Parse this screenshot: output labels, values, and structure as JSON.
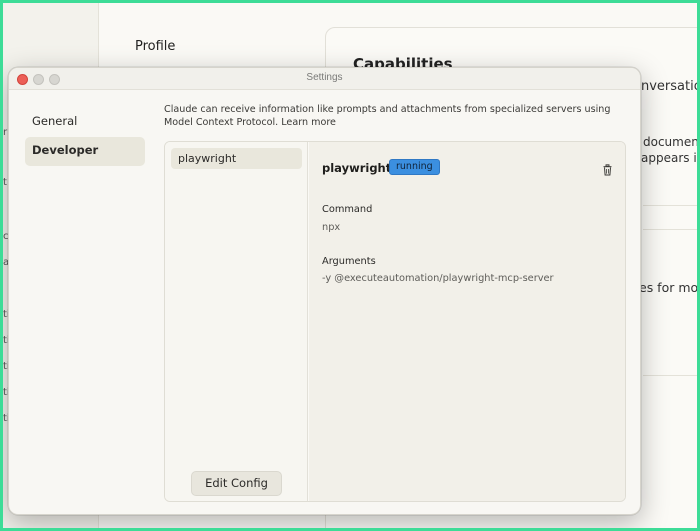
{
  "background": {
    "profile_label": "Profile",
    "capabilities_heading": "Capabilities",
    "fragment_conversation": "nversatio",
    "fragment_documents": "documents",
    "fragment_appears": "appears in",
    "fragment_more": "es for mor",
    "left_clips": [
      "r",
      "t",
      "c",
      "a",
      "ti",
      "ti",
      "ti",
      "ti",
      "ti"
    ]
  },
  "window": {
    "title": "Settings"
  },
  "nav": {
    "items": [
      {
        "label": "General",
        "active": false
      },
      {
        "label": "Developer",
        "active": true
      }
    ]
  },
  "intro_text": "Claude can receive information like prompts and attachments from specialized servers using Model Context Protocol. Learn more",
  "servers": {
    "items": [
      {
        "label": "playwright"
      }
    ],
    "edit_config_label": "Edit Config"
  },
  "detail": {
    "name": "playwright",
    "status": "running",
    "status_color": "#3b8fe0",
    "delete_icon": "trash-icon",
    "command_label": "Command",
    "command_value": "npx",
    "arguments_label": "Arguments",
    "arguments_value": "-y @executeautomation/playwright-mcp-server"
  }
}
